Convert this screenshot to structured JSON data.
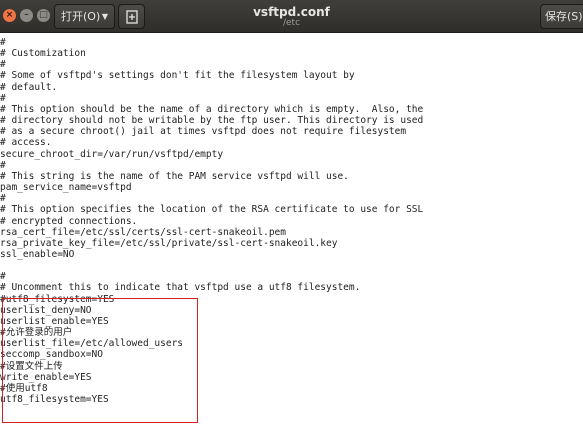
{
  "window": {
    "title": "vsftpd.conf",
    "subtitle": "/etc",
    "open_label": "打开(O)",
    "save_label": "保存(S)"
  },
  "editor": {
    "lines": [
      "#",
      "# Customization",
      "#",
      "# Some of vsftpd's settings don't fit the filesystem layout by",
      "# default.",
      "#",
      "# This option should be the name of a directory which is empty.  Also, the",
      "# directory should not be writable by the ftp user. This directory is used",
      "# as a secure chroot() jail at times vsftpd does not require filesystem",
      "# access.",
      "secure_chroot_dir=/var/run/vsftpd/empty",
      "#",
      "# This string is the name of the PAM service vsftpd will use.",
      "pam_service_name=vsftpd",
      "#",
      "# This option specifies the location of the RSA certificate to use for SSL",
      "# encrypted connections.",
      "rsa_cert_file=/etc/ssl/certs/ssl-cert-snakeoil.pem",
      "rsa_private_key_file=/etc/ssl/private/ssl-cert-snakeoil.key",
      "ssl_enable=NO",
      "",
      "#",
      "# Uncomment this to indicate that vsftpd use a utf8 filesystem.",
      "#utf8_filesystem=YES",
      "userlist_deny=NO",
      "userlist_enable=YES",
      "#允许登录的用户",
      "userlist_file=/etc/allowed_users",
      "seccomp_sandbox=NO",
      "#设置文件上传",
      "write_enable=YES",
      "#使用utf8",
      "utf8_filesystem=YES"
    ]
  },
  "colors": {
    "titlebar": "#3c3b37",
    "highlight_border": "#d42020",
    "close_button": "#ef7445"
  }
}
